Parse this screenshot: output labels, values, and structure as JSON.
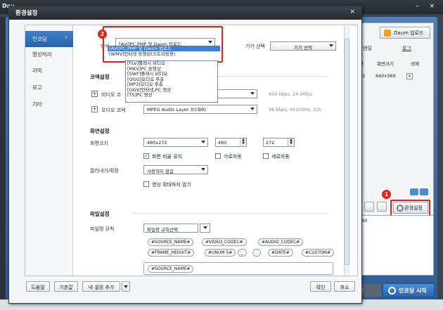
{
  "background_app": {
    "title": "Dau",
    "daum_upload_label": "Daum 업로드",
    "tab_left": "엔딩",
    "tab_right": "로그",
    "header": [
      "간",
      "화면크기",
      "삭제"
    ],
    "row": [
      "32",
      "640x360",
      "×"
    ],
    "env_settings_label": "환경설정",
    "lower_text": ":40",
    "settings_partial": "설정",
    "encode_start_label": "인코딩 시작",
    "badge_1": "1",
    "badge_2": "2"
  },
  "dialog": {
    "title": "환경설정",
    "close": "×",
    "nav": [
      {
        "label": "인코딩"
      },
      {
        "label": "영상처리"
      },
      {
        "label": "자막"
      },
      {
        "label": "로고"
      },
      {
        "label": "기타"
      }
    ],
    "top": {
      "mode_label_partial": "방식",
      "mode_value": "[AVI]PC,PMP 및 Daum 업로드",
      "device_label": "기기 선택",
      "device_button": "기기 선택"
    },
    "mode_dropdown_options": [
      {
        "label": "[AVI]PC,PMP 및 Daum 업로드",
        "selected": true
      },
      {
        "label": "[WMV]인터넷 동영상(스트리밍용)",
        "selected": false
      }
    ],
    "mode_dropdown_more": [
      "[FLV]플래시 비디오",
      "[MKV]PC 동영상",
      "[SWF]플래시 비디오",
      "[OGG]오디오 추출",
      "[MP3]오디오 추출",
      "[OGV]인터넷,PC 영상",
      "[TS]PC 영상"
    ],
    "codec_section": {
      "title": "코덱설정",
      "video_label": "비디오 코",
      "video_hint": "600 kbps, 24.00fps",
      "audio_label": "오디오 코덱",
      "audio_value": "MPEG Audio Layer 3(CBR)",
      "audio_hint": "96 kbps, 44100Hz, 2ch"
    },
    "screen_section": {
      "title": "화면설정",
      "size_label": "화면크기",
      "size_value": "480x272",
      "width": "480",
      "height": "272",
      "keep_ratio": "화면 비율 유지",
      "keep_ratio_checked": true,
      "auto_width": "가로자동",
      "auto_height": "세로자동",
      "crop_label": "잘라내기/확장",
      "crop_value": "사용하지 않음",
      "no_enlarge": "영상 확대하지 않기"
    },
    "file_section": {
      "title": "파일설정",
      "rule_label": "파일명 규칙",
      "rule_value": "파일명 규칙선택",
      "tokens_row1": [
        "#SOURCE_NAME#",
        "#VIDEO_CODEC#",
        "#AUDIO_CODEC#"
      ],
      "tokens_row2": [
        "#FRAME_HEIGHT#",
        "#UNUM 5#",
        "_",
        ".",
        "#DATE#",
        "#CUSTOM#"
      ],
      "name_token": "#SOURCE_NAME#"
    },
    "footer": {
      "help": "도움말",
      "default": "기본값",
      "add_setting": "내 설정 추가",
      "ok": "확인",
      "cancel": "취소"
    }
  }
}
